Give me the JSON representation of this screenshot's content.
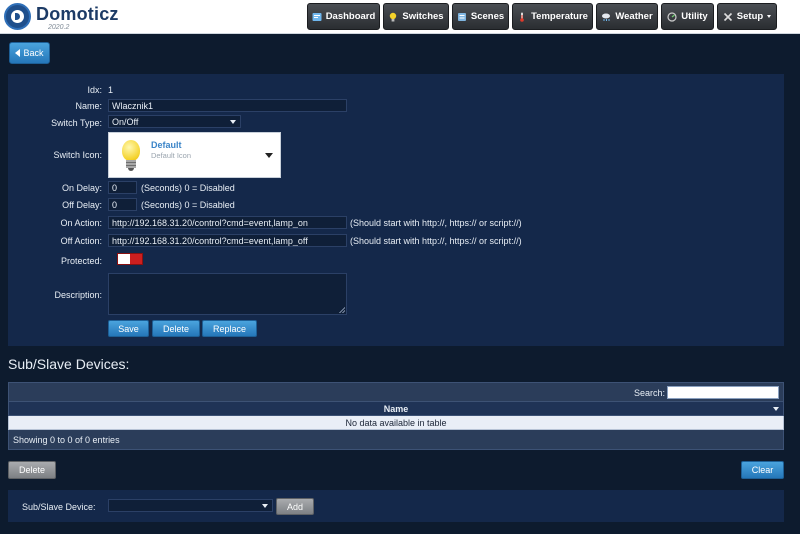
{
  "app": {
    "name": "Domoticz",
    "version": "2020.2"
  },
  "nav": [
    {
      "label": "Dashboard",
      "icon": "dashboard-icon"
    },
    {
      "label": "Switches",
      "icon": "lightbulb-icon"
    },
    {
      "label": "Scenes",
      "icon": "scenes-icon"
    },
    {
      "label": "Temperature",
      "icon": "thermometer-icon"
    },
    {
      "label": "Weather",
      "icon": "weather-icon"
    },
    {
      "label": "Utility",
      "icon": "utility-icon"
    },
    {
      "label": "Setup",
      "icon": "wrench-icon"
    }
  ],
  "back_label": "Back",
  "form": {
    "idx_label": "Idx:",
    "idx_value": "1",
    "name_label": "Name:",
    "name_value": "Wlacznik1",
    "switch_type_label": "Switch Type:",
    "switch_type_value": "On/Off",
    "switch_icon_label": "Switch Icon:",
    "icon_title": "Default",
    "icon_desc": "Default Icon",
    "on_delay_label": "On Delay:",
    "on_delay_value": "0",
    "on_delay_hint": "(Seconds) 0 = Disabled",
    "off_delay_label": "Off Delay:",
    "off_delay_value": "0",
    "off_delay_hint": "(Seconds) 0 = Disabled",
    "on_action_label": "On Action:",
    "on_action_value": "http://192.168.31.20/control?cmd=event,lamp_on",
    "on_action_hint": "(Should start with http://, https:// or script://)",
    "off_action_label": "Off Action:",
    "off_action_value": "http://192.168.31.20/control?cmd=event,lamp_off",
    "off_action_hint": "(Should start with http://, https:// or script://)",
    "protected_label": "Protected:",
    "description_label": "Description:",
    "description_value": "",
    "save_label": "Save",
    "delete_label": "Delete",
    "replace_label": "Replace"
  },
  "subslave": {
    "title": "Sub/Slave Devices:",
    "search_label": "Search:",
    "column_name": "Name",
    "empty_text": "No data available in table",
    "info_text": "Showing 0 to 0 of 0 entries",
    "delete_label": "Delete",
    "clear_label": "Clear",
    "device_label": "Sub/Slave Device:",
    "device_value": "",
    "add_label": "Add"
  },
  "colors": {
    "background": "#0d1b2e",
    "panel": "#14284a",
    "accent": "#2577b9",
    "toggle_off": "#cc1f1f"
  }
}
